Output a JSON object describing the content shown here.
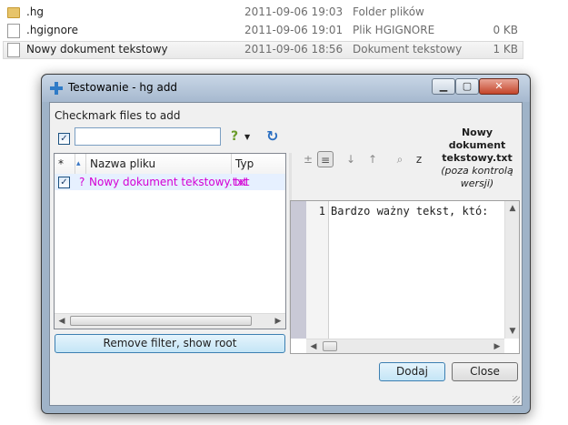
{
  "explorer": {
    "rows": [
      {
        "name": ".hg",
        "date": "2011-09-06 19:03",
        "type": "Folder plików",
        "size": "",
        "icon": "folder-icon"
      },
      {
        "name": ".hgignore",
        "date": "2011-09-06 19:01",
        "type": "Plik HGIGNORE",
        "size": "0 KB",
        "icon": "document-icon"
      },
      {
        "name": "Nowy dokument tekstowy",
        "date": "2011-09-06 18:56",
        "type": "Dokument tekstowy",
        "size": "1 KB",
        "icon": "document-icon"
      }
    ]
  },
  "dialog": {
    "title": "Testowanie - hg add",
    "checkmark_label": "Checkmark files to add",
    "filter_placeholder": "",
    "columns": {
      "status": "*",
      "name": "Nazwa pliku",
      "type": "Typ"
    },
    "files": [
      {
        "status": "?",
        "name": "Nowy dokument tekstowy.txt",
        "type": "txt",
        "checked": true
      }
    ],
    "remove_filter_button": "Remove filter, show root",
    "preview": {
      "filename": "Nowy dokument tekstowy.txt",
      "status_note": "(poza kontrolą wersji)",
      "line_number": "1",
      "line_text": "Bardzo ważny tekst, któ:"
    },
    "add_button": "Dodaj",
    "close_button": "Close",
    "colors": {
      "untracked_file": "#d400d4",
      "selection": "#e6f0ff"
    }
  }
}
